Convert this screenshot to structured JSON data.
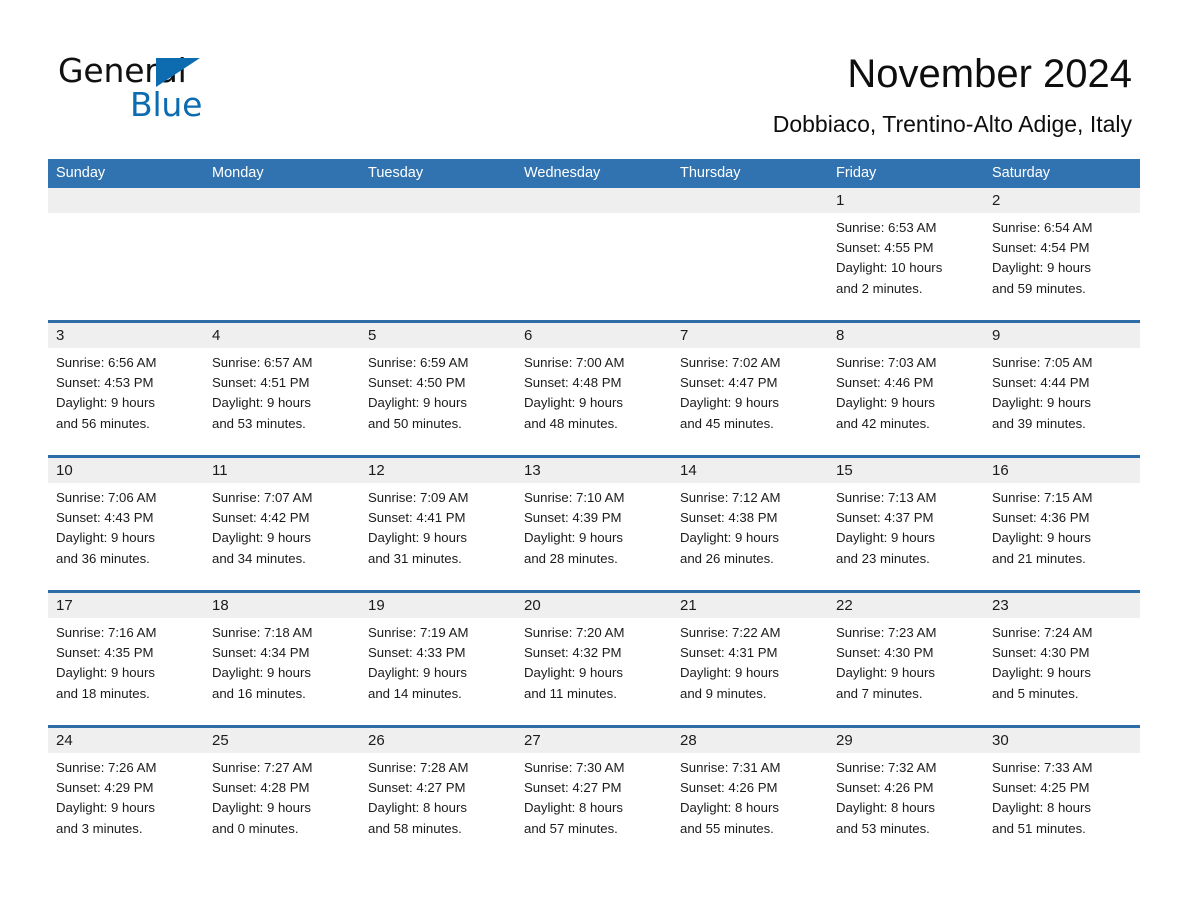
{
  "brand": {
    "name_part1": "General",
    "name_part2": "Blue",
    "triangle_color": "#0d6cb0",
    "text_color": "#111111"
  },
  "header": {
    "title": "November 2024",
    "subtitle": "Dobbiaco, Trentino-Alto Adige, Italy"
  },
  "colors": {
    "header_blue": "#3173b0",
    "row_divider_blue": "#2d6ca6",
    "daynum_band": "#efefef",
    "text": "#1b1b1b"
  },
  "weekdays": [
    "Sunday",
    "Monday",
    "Tuesday",
    "Wednesday",
    "Thursday",
    "Friday",
    "Saturday"
  ],
  "calendar_data": {
    "month": "November",
    "year": 2024,
    "location": "Dobbiaco, Trentino-Alto Adige, Italy",
    "weeks": [
      [
        {
          "day": ""
        },
        {
          "day": ""
        },
        {
          "day": ""
        },
        {
          "day": ""
        },
        {
          "day": ""
        },
        {
          "day": "1",
          "sunrise": "Sunrise: 6:53 AM",
          "sunset": "Sunset: 4:55 PM",
          "daylight_line1": "Daylight: 10 hours",
          "daylight_line2": "and 2 minutes."
        },
        {
          "day": "2",
          "sunrise": "Sunrise: 6:54 AM",
          "sunset": "Sunset: 4:54 PM",
          "daylight_line1": "Daylight: 9 hours",
          "daylight_line2": "and 59 minutes."
        }
      ],
      [
        {
          "day": "3",
          "sunrise": "Sunrise: 6:56 AM",
          "sunset": "Sunset: 4:53 PM",
          "daylight_line1": "Daylight: 9 hours",
          "daylight_line2": "and 56 minutes."
        },
        {
          "day": "4",
          "sunrise": "Sunrise: 6:57 AM",
          "sunset": "Sunset: 4:51 PM",
          "daylight_line1": "Daylight: 9 hours",
          "daylight_line2": "and 53 minutes."
        },
        {
          "day": "5",
          "sunrise": "Sunrise: 6:59 AM",
          "sunset": "Sunset: 4:50 PM",
          "daylight_line1": "Daylight: 9 hours",
          "daylight_line2": "and 50 minutes."
        },
        {
          "day": "6",
          "sunrise": "Sunrise: 7:00 AM",
          "sunset": "Sunset: 4:48 PM",
          "daylight_line1": "Daylight: 9 hours",
          "daylight_line2": "and 48 minutes."
        },
        {
          "day": "7",
          "sunrise": "Sunrise: 7:02 AM",
          "sunset": "Sunset: 4:47 PM",
          "daylight_line1": "Daylight: 9 hours",
          "daylight_line2": "and 45 minutes."
        },
        {
          "day": "8",
          "sunrise": "Sunrise: 7:03 AM",
          "sunset": "Sunset: 4:46 PM",
          "daylight_line1": "Daylight: 9 hours",
          "daylight_line2": "and 42 minutes."
        },
        {
          "day": "9",
          "sunrise": "Sunrise: 7:05 AM",
          "sunset": "Sunset: 4:44 PM",
          "daylight_line1": "Daylight: 9 hours",
          "daylight_line2": "and 39 minutes."
        }
      ],
      [
        {
          "day": "10",
          "sunrise": "Sunrise: 7:06 AM",
          "sunset": "Sunset: 4:43 PM",
          "daylight_line1": "Daylight: 9 hours",
          "daylight_line2": "and 36 minutes."
        },
        {
          "day": "11",
          "sunrise": "Sunrise: 7:07 AM",
          "sunset": "Sunset: 4:42 PM",
          "daylight_line1": "Daylight: 9 hours",
          "daylight_line2": "and 34 minutes."
        },
        {
          "day": "12",
          "sunrise": "Sunrise: 7:09 AM",
          "sunset": "Sunset: 4:41 PM",
          "daylight_line1": "Daylight: 9 hours",
          "daylight_line2": "and 31 minutes."
        },
        {
          "day": "13",
          "sunrise": "Sunrise: 7:10 AM",
          "sunset": "Sunset: 4:39 PM",
          "daylight_line1": "Daylight: 9 hours",
          "daylight_line2": "and 28 minutes."
        },
        {
          "day": "14",
          "sunrise": "Sunrise: 7:12 AM",
          "sunset": "Sunset: 4:38 PM",
          "daylight_line1": "Daylight: 9 hours",
          "daylight_line2": "and 26 minutes."
        },
        {
          "day": "15",
          "sunrise": "Sunrise: 7:13 AM",
          "sunset": "Sunset: 4:37 PM",
          "daylight_line1": "Daylight: 9 hours",
          "daylight_line2": "and 23 minutes."
        },
        {
          "day": "16",
          "sunrise": "Sunrise: 7:15 AM",
          "sunset": "Sunset: 4:36 PM",
          "daylight_line1": "Daylight: 9 hours",
          "daylight_line2": "and 21 minutes."
        }
      ],
      [
        {
          "day": "17",
          "sunrise": "Sunrise: 7:16 AM",
          "sunset": "Sunset: 4:35 PM",
          "daylight_line1": "Daylight: 9 hours",
          "daylight_line2": "and 18 minutes."
        },
        {
          "day": "18",
          "sunrise": "Sunrise: 7:18 AM",
          "sunset": "Sunset: 4:34 PM",
          "daylight_line1": "Daylight: 9 hours",
          "daylight_line2": "and 16 minutes."
        },
        {
          "day": "19",
          "sunrise": "Sunrise: 7:19 AM",
          "sunset": "Sunset: 4:33 PM",
          "daylight_line1": "Daylight: 9 hours",
          "daylight_line2": "and 14 minutes."
        },
        {
          "day": "20",
          "sunrise": "Sunrise: 7:20 AM",
          "sunset": "Sunset: 4:32 PM",
          "daylight_line1": "Daylight: 9 hours",
          "daylight_line2": "and 11 minutes."
        },
        {
          "day": "21",
          "sunrise": "Sunrise: 7:22 AM",
          "sunset": "Sunset: 4:31 PM",
          "daylight_line1": "Daylight: 9 hours",
          "daylight_line2": "and 9 minutes."
        },
        {
          "day": "22",
          "sunrise": "Sunrise: 7:23 AM",
          "sunset": "Sunset: 4:30 PM",
          "daylight_line1": "Daylight: 9 hours",
          "daylight_line2": "and 7 minutes."
        },
        {
          "day": "23",
          "sunrise": "Sunrise: 7:24 AM",
          "sunset": "Sunset: 4:30 PM",
          "daylight_line1": "Daylight: 9 hours",
          "daylight_line2": "and 5 minutes."
        }
      ],
      [
        {
          "day": "24",
          "sunrise": "Sunrise: 7:26 AM",
          "sunset": "Sunset: 4:29 PM",
          "daylight_line1": "Daylight: 9 hours",
          "daylight_line2": "and 3 minutes."
        },
        {
          "day": "25",
          "sunrise": "Sunrise: 7:27 AM",
          "sunset": "Sunset: 4:28 PM",
          "daylight_line1": "Daylight: 9 hours",
          "daylight_line2": "and 0 minutes."
        },
        {
          "day": "26",
          "sunrise": "Sunrise: 7:28 AM",
          "sunset": "Sunset: 4:27 PM",
          "daylight_line1": "Daylight: 8 hours",
          "daylight_line2": "and 58 minutes."
        },
        {
          "day": "27",
          "sunrise": "Sunrise: 7:30 AM",
          "sunset": "Sunset: 4:27 PM",
          "daylight_line1": "Daylight: 8 hours",
          "daylight_line2": "and 57 minutes."
        },
        {
          "day": "28",
          "sunrise": "Sunrise: 7:31 AM",
          "sunset": "Sunset: 4:26 PM",
          "daylight_line1": "Daylight: 8 hours",
          "daylight_line2": "and 55 minutes."
        },
        {
          "day": "29",
          "sunrise": "Sunrise: 7:32 AM",
          "sunset": "Sunset: 4:26 PM",
          "daylight_line1": "Daylight: 8 hours",
          "daylight_line2": "and 53 minutes."
        },
        {
          "day": "30",
          "sunrise": "Sunrise: 7:33 AM",
          "sunset": "Sunset: 4:25 PM",
          "daylight_line1": "Daylight: 8 hours",
          "daylight_line2": "and 51 minutes."
        }
      ]
    ]
  }
}
